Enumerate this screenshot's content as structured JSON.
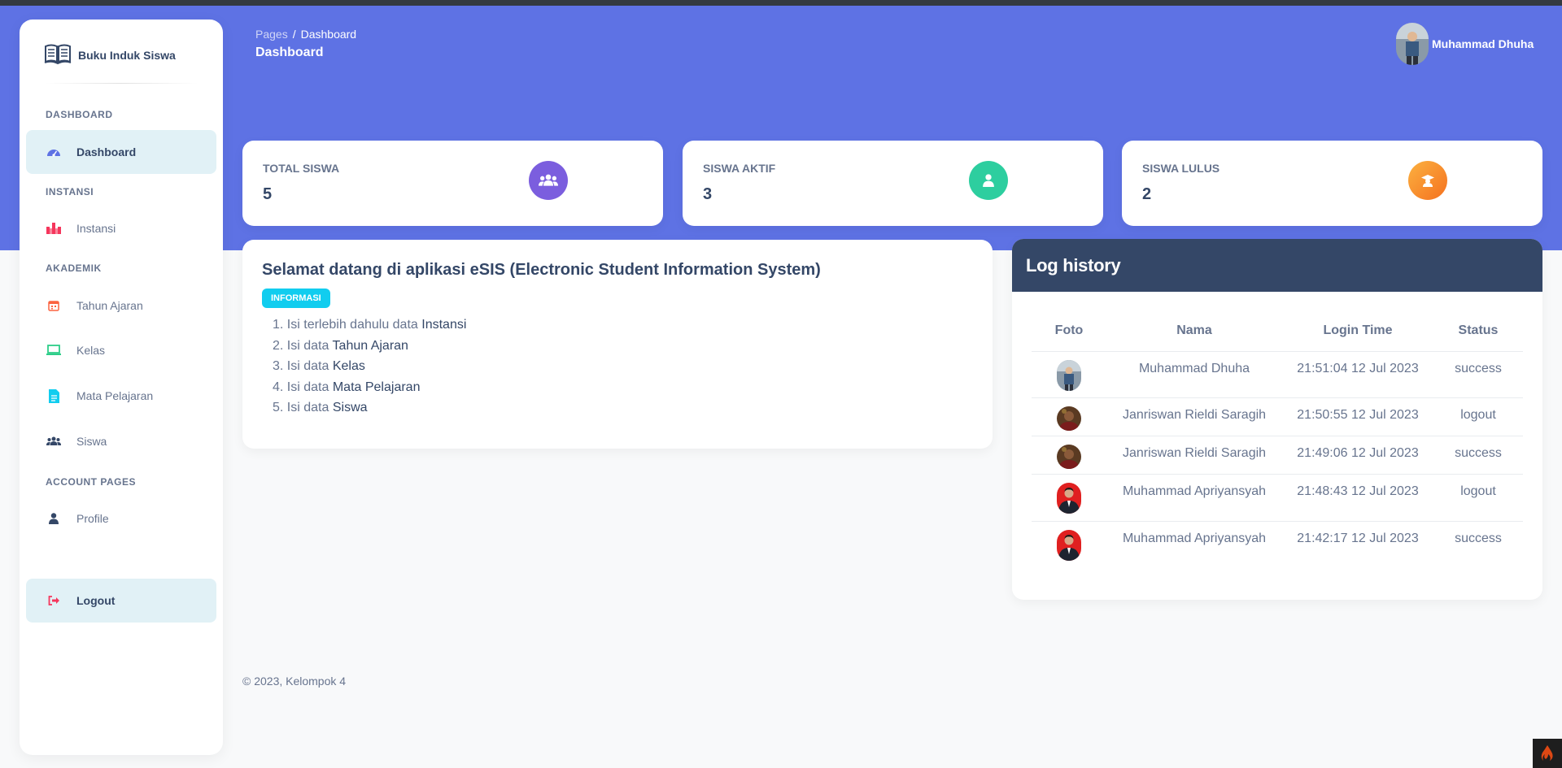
{
  "sidebar": {
    "brand": "Buku Induk Siswa",
    "sections": {
      "dashboard": "DASHBOARD",
      "instansi": "INSTANSI",
      "akademik": "AKADEMIK",
      "account": "ACCOUNT PAGES"
    },
    "items": {
      "dashboard": "Dashboard",
      "instansi": "Instansi",
      "tahun_ajaran": "Tahun Ajaran",
      "kelas": "Kelas",
      "mata_pelajaran": "Mata Pelajaran",
      "siswa": "Siswa",
      "profile": "Profile",
      "logout": "Logout"
    },
    "icons": {
      "brand": "book-icon",
      "dashboard": "gauge-icon",
      "instansi": "building-icon",
      "tahun_ajaran": "calendar-icon",
      "kelas": "laptop-icon",
      "mata_pelajaran": "document-icon",
      "siswa": "users-icon",
      "profile": "user-icon",
      "logout": "sign-out-icon"
    }
  },
  "header": {
    "breadcrumb_root": "Pages",
    "breadcrumb_sep": "/",
    "breadcrumb_current": "Dashboard",
    "title": "Dashboard",
    "user_name": "Muhammad Dhuha"
  },
  "stats": {
    "total": {
      "label": "TOTAL SISWA",
      "value": "5",
      "icon": "users-icon",
      "color": "#7b5ede"
    },
    "aktif": {
      "label": "SISWA AKTIF",
      "value": "3",
      "icon": "user-icon",
      "color": "#2dce9f"
    },
    "lulus": {
      "label": "SISWA LULUS",
      "value": "2",
      "icon": "graduate-icon",
      "color": "#fb8c3a"
    }
  },
  "welcome": {
    "title": "Selamat datang di aplikasi eSIS (Electronic Student Information System)",
    "badge": "INFORMASI",
    "steps": [
      {
        "num": "1.",
        "text": "Isi terlebih dahulu data",
        "em": "Instansi"
      },
      {
        "num": "2.",
        "text": "Isi data",
        "em": "Tahun Ajaran"
      },
      {
        "num": "3.",
        "text": "Isi data",
        "em": "Kelas"
      },
      {
        "num": "4.",
        "text": "Isi data",
        "em": "Mata Pelajaran"
      },
      {
        "num": "5.",
        "text": "Isi data",
        "em": "Siswa"
      }
    ]
  },
  "log": {
    "title": "Log history",
    "columns": [
      "Foto",
      "Nama",
      "Login Time",
      "Status"
    ],
    "rows": [
      {
        "name": "Muhammad Dhuha",
        "time": "21:51:04 12 Jul 2023",
        "status": "success"
      },
      {
        "name": "Janriswan Rieldi Saragih",
        "time": "21:50:55 12 Jul 2023",
        "status": "logout"
      },
      {
        "name": "Janriswan Rieldi Saragih",
        "time": "21:49:06 12 Jul 2023",
        "status": "success"
      },
      {
        "name": "Muhammad Apriyansyah",
        "time": "21:48:43 12 Jul 2023",
        "status": "logout"
      },
      {
        "name": "Muhammad Apriyansyah",
        "time": "21:42:17 12 Jul 2023",
        "status": "success"
      }
    ]
  },
  "footer": {
    "text": "© 2023, Kelompok 4"
  },
  "colors": {
    "primary": "#5e72e4",
    "dark": "#344767",
    "info": "#11cdef"
  }
}
